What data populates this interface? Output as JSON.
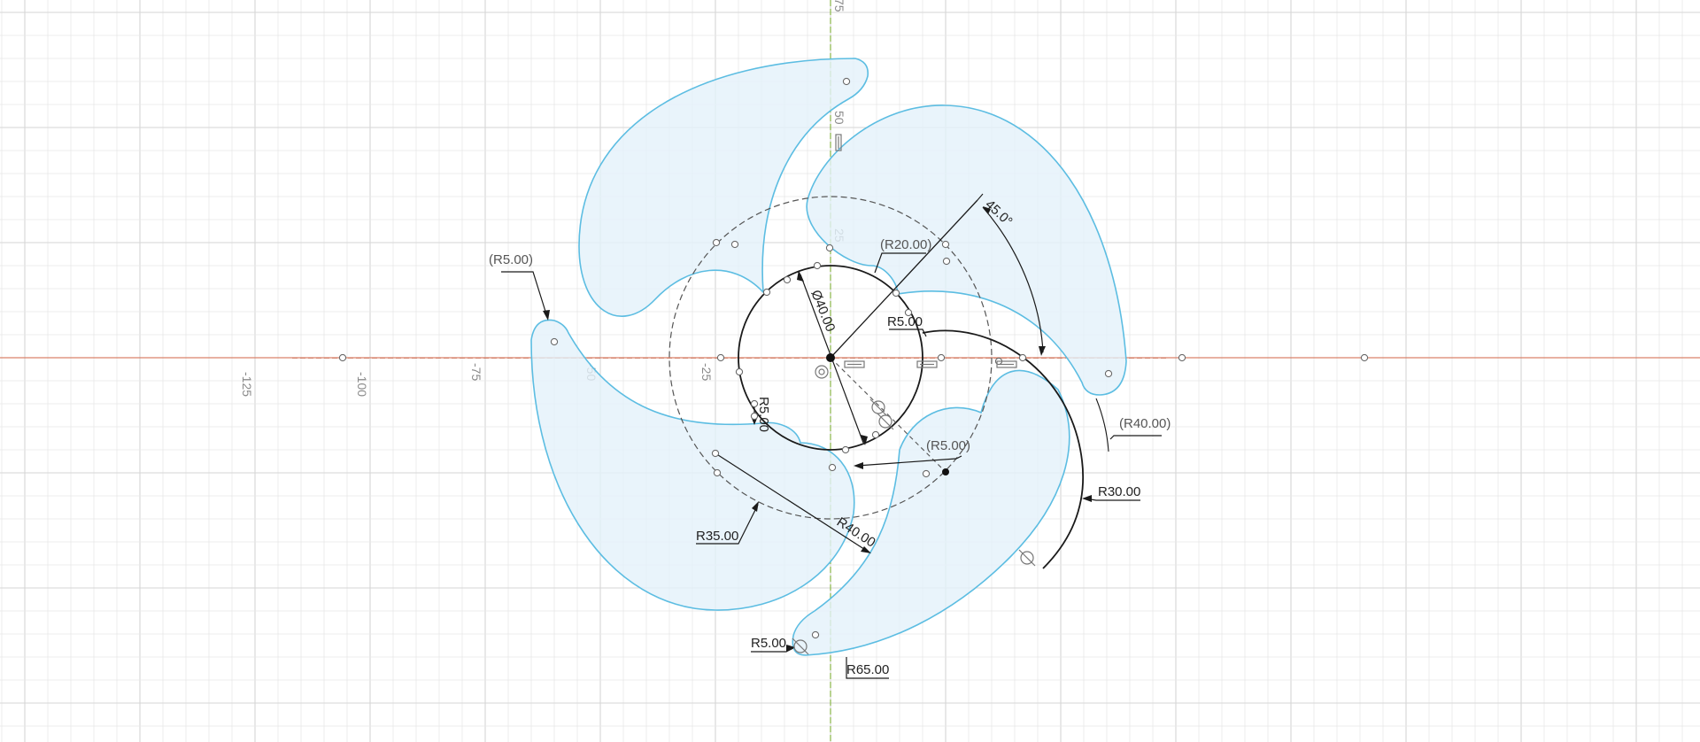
{
  "sketch": {
    "axis_labels": {
      "x_negative": [
        "-125",
        "-100",
        "-75",
        "-50",
        "-25"
      ],
      "y_positive": [
        "25",
        "50",
        "75"
      ]
    },
    "dimensions": {
      "diameter_hub": "Ø40.00",
      "angle": "45.0°",
      "ref_radius_20": "(R20.00)",
      "ref_radius_5_left": "(R5.00)",
      "ref_radius_5_right": "(R5.00)",
      "ref_radius_40": "(R40.00)",
      "radius_5_top": "R5.00",
      "radius_5_inner": "R5.00",
      "radius_5_bottom": "R5.00",
      "radius_30": "R30.00",
      "radius_35": "R35.00",
      "radius_40": "R40.00",
      "radius_65": "R65.00"
    },
    "colors": {
      "blade_fill": "#e3f1fa",
      "blade_stroke": "#5cbde2",
      "x_axis": "#d9826a",
      "y_axis": "#8bb84a",
      "grid": "#e8e8e8"
    },
    "icons": [
      "tangent-constraint-icon",
      "parallel-constraint-icon",
      "coincident-constraint-icon",
      "horizontal-constraint-icon",
      "vertical-constraint-icon"
    ]
  }
}
